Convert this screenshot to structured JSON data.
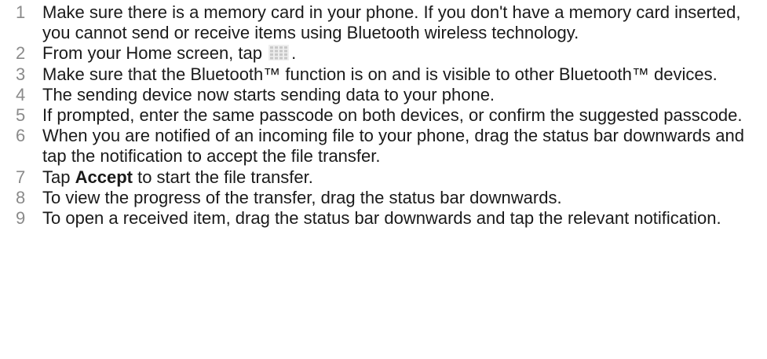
{
  "steps": [
    {
      "number": "1",
      "text": "Make sure there is a memory card in your phone. If you don't have a memory card inserted, you cannot send or receive items using Bluetooth wireless technology."
    },
    {
      "number": "2",
      "text_before": "From your Home screen, tap",
      "icon": "apps-grid-icon",
      "text_after": "."
    },
    {
      "number": "3",
      "text": "Make sure that the Bluetooth™ function is on and is visible to other Bluetooth™ devices."
    },
    {
      "number": "4",
      "text": "The sending device now starts sending data to your phone."
    },
    {
      "number": "5",
      "text": "If prompted, enter the same passcode on both devices, or confirm the suggested passcode."
    },
    {
      "number": "6",
      "text": "When you are notified of an incoming file to your phone, drag the status bar downwards and tap the notification to accept the file transfer."
    },
    {
      "number": "7",
      "text_before": "Tap",
      "bold": "Accept",
      "text_after": "to start the file transfer."
    },
    {
      "number": "8",
      "text": "To view the progress of the transfer, drag the status bar downwards."
    },
    {
      "number": "9",
      "text": "To open a received item, drag the status bar downwards and tap the relevant notification."
    }
  ]
}
